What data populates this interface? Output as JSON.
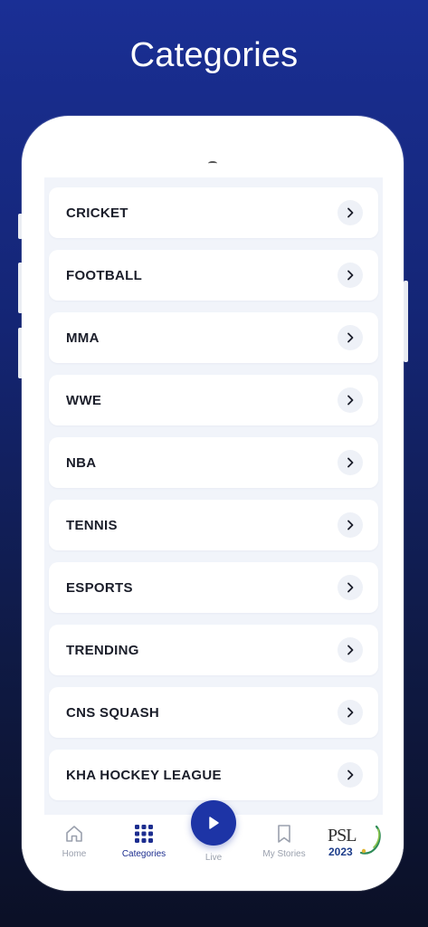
{
  "page": {
    "title": "Categories"
  },
  "categories": [
    {
      "label": "CRICKET"
    },
    {
      "label": "FOOTBALL"
    },
    {
      "label": "MMA"
    },
    {
      "label": "WWE"
    },
    {
      "label": "NBA"
    },
    {
      "label": "TENNIS"
    },
    {
      "label": "ESPORTS"
    },
    {
      "label": "TRENDING"
    },
    {
      "label": "CNS SQUASH"
    },
    {
      "label": "KHA HOCKEY LEAGUE"
    }
  ],
  "nav": {
    "home": "Home",
    "categories": "Categories",
    "live": "Live",
    "stories": "My Stories"
  },
  "badge": {
    "text": "PSL",
    "year": "2023"
  },
  "colors": {
    "accent": "#1d34a6",
    "active_nav": "#1c2d8f",
    "inactive_nav": "#9aa0ad",
    "list_bg": "#f1f4fa",
    "text": "#1b1e2a"
  },
  "icons": {
    "chevron": "chevron-right-icon",
    "home": "home-icon",
    "categories": "grid-icon",
    "live": "play-icon",
    "stories": "bookmark-icon"
  }
}
